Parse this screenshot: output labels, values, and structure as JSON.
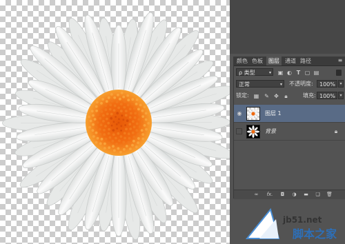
{
  "panel": {
    "tabs": [
      {
        "label": "颜色",
        "active": false
      },
      {
        "label": "色板",
        "active": false
      },
      {
        "label": "图层",
        "active": true
      },
      {
        "label": "通道",
        "active": false
      },
      {
        "label": "路径",
        "active": false
      }
    ],
    "menu_icon": "panel-menu-icon"
  },
  "filter": {
    "kind_label": "ρ 类型",
    "icons": [
      "pixel-filter-icon",
      "adjustment-filter-icon",
      "type-filter-icon",
      "shape-filter-icon",
      "smart-object-filter-icon",
      "filter-toggle-icon"
    ]
  },
  "blend": {
    "mode": "正常",
    "opacity_label": "不透明度:",
    "opacity_value": "100%"
  },
  "lock": {
    "label": "锁定:",
    "icons": [
      "lock-transparent-icon",
      "lock-pixels-icon",
      "lock-position-icon",
      "lock-all-icon"
    ],
    "fill_label": "填充:",
    "fill_value": "100%"
  },
  "layers": [
    {
      "name": "图层 1",
      "visible": true,
      "selected": true,
      "italic": false,
      "locked": false
    },
    {
      "name": "背景",
      "visible": false,
      "selected": false,
      "italic": true,
      "locked": true
    }
  ],
  "footer_icons": [
    "link-layers-icon",
    "fx-icon",
    "add-mask-icon",
    "adjustment-layer-icon",
    "group-icon",
    "new-layer-icon",
    "delete-layer-icon"
  ],
  "footer": {
    "fx_label": "fx."
  },
  "watermark": {
    "url": "jb51.net",
    "text": "脚本之家"
  },
  "colors": {
    "selected_layer": "#596b86",
    "petal": "#f4f5f4",
    "center": "#f06a10",
    "watermark_blue": "#2d6fb8"
  }
}
